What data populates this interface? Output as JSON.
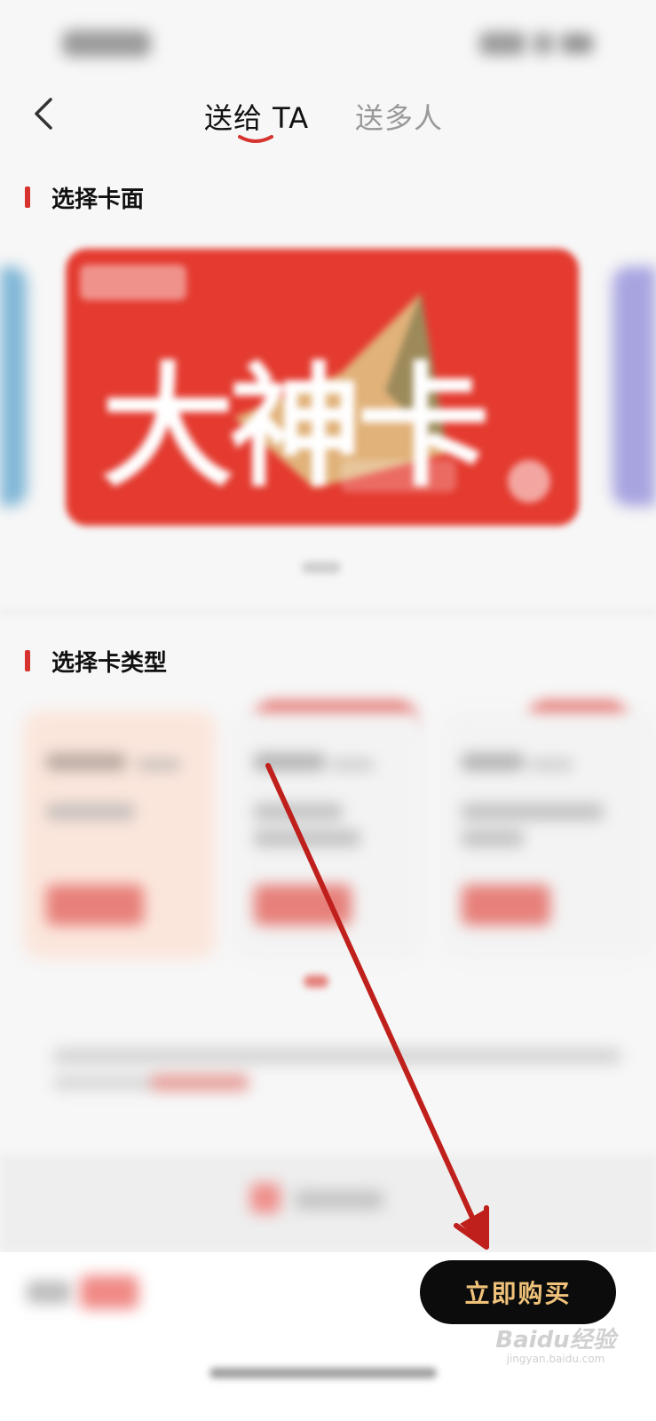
{
  "header": {
    "tabs": [
      {
        "label": "送给 TA",
        "active": true
      },
      {
        "label": "送多人",
        "active": false
      }
    ]
  },
  "sections": {
    "card_face_title": "选择卡面",
    "card_type_title": "选择卡类型"
  },
  "card_face": {
    "label": "大神卡"
  },
  "bottom_bar": {
    "buy_label": "立即购买"
  },
  "watermark": {
    "brand": "Baidu经验",
    "domain": "jingyan.baidu.com"
  },
  "colors": {
    "accent": "#d6322e",
    "card_red": "#e43a2f",
    "buy_text": "#f0c27a",
    "annotation_arrow": "#c0201c"
  },
  "icons": {
    "back": "chevron-left-icon",
    "annotation": "arrow-annotation"
  }
}
